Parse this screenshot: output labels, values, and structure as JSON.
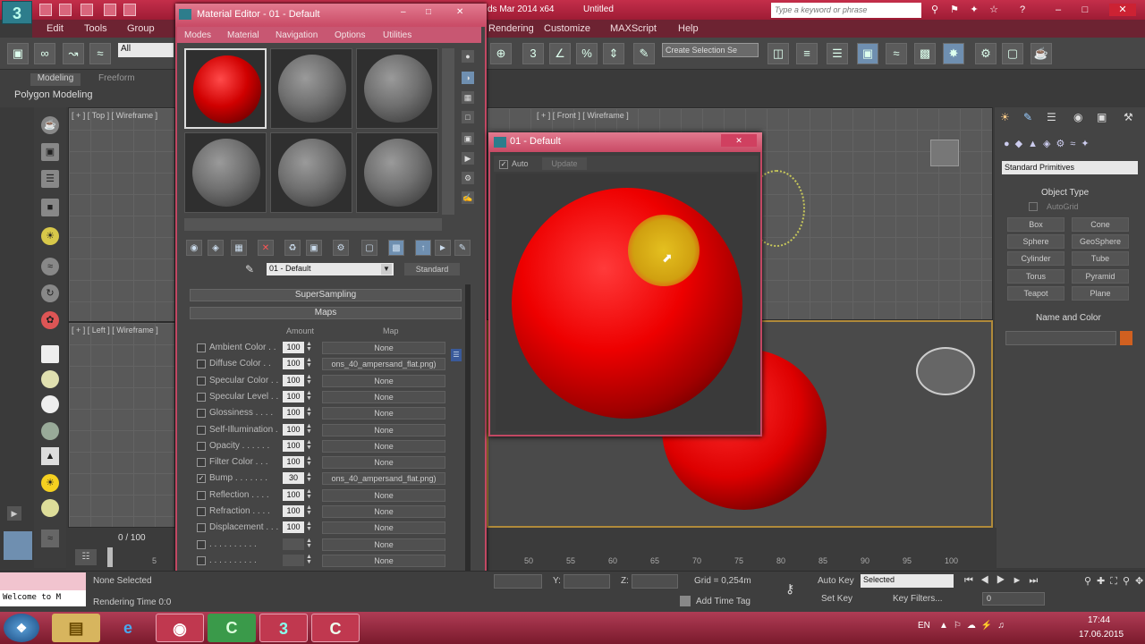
{
  "app": {
    "title_fragment": "ds Mar 2014 x64",
    "doc_title": "Untitled",
    "search_placeholder": "Type a keyword or phrase",
    "app_icon": "3ds-max-icon"
  },
  "menubar": [
    "Edit",
    "Tools",
    "Group",
    "Rendering",
    "Customize",
    "MAXScript",
    "Help"
  ],
  "toolbar": {
    "selection_filter": "All",
    "named_selection": "Create Selection Se"
  },
  "ribbon": {
    "tabs": [
      "Modeling",
      "Freeform"
    ],
    "sub": "Polygon Modeling"
  },
  "viewports": {
    "top": "[ + ] [ Top ] [ Wireframe ]",
    "front": "[ + ] [ Front ] [ Wireframe ]",
    "left": "[ + ] [ Left ] [ Wireframe ]"
  },
  "material_editor": {
    "title": "Material Editor - 01 - Default",
    "menus": [
      "Modes",
      "Material",
      "Navigation",
      "Options",
      "Utilities"
    ],
    "material_name": "01 - Default",
    "material_type": "Standard",
    "rollouts": {
      "supersampling": "SuperSampling",
      "maps": "Maps"
    },
    "maps_header": {
      "amount": "Amount",
      "map": "Map"
    },
    "maps": [
      {
        "label": "Ambient Color . .",
        "amount": "100",
        "map": "None",
        "checked": false
      },
      {
        "label": "Diffuse Color . .",
        "amount": "100",
        "map": "ons_40_ampersand_flat.png)",
        "checked": false
      },
      {
        "label": "Specular Color . .",
        "amount": "100",
        "map": "None",
        "checked": false
      },
      {
        "label": "Specular Level . .",
        "amount": "100",
        "map": "None",
        "checked": false
      },
      {
        "label": "Glossiness . . . .",
        "amount": "100",
        "map": "None",
        "checked": false
      },
      {
        "label": "Self-Illumination .",
        "amount": "100",
        "map": "None",
        "checked": false
      },
      {
        "label": "Opacity . . . . . .",
        "amount": "100",
        "map": "None",
        "checked": false
      },
      {
        "label": "Filter Color . . .",
        "amount": "100",
        "map": "None",
        "checked": false
      },
      {
        "label": "Bump . . . . . . .",
        "amount": "30",
        "map": "ons_40_ampersand_flat.png)",
        "checked": true
      },
      {
        "label": "Reflection . . . .",
        "amount": "100",
        "map": "None",
        "checked": false
      },
      {
        "label": "Refraction . . . .",
        "amount": "100",
        "map": "None",
        "checked": false
      },
      {
        "label": "Displacement . . .",
        "amount": "100",
        "map": "None",
        "checked": false
      },
      {
        "label": ". . . . . . . . . .",
        "amount": "",
        "map": "None",
        "checked": false
      },
      {
        "label": ". . . . . . . . . .",
        "amount": "",
        "map": "None",
        "checked": false
      },
      {
        "label": ". . . . . . . . . .",
        "amount": "",
        "map": "None",
        "checked": false
      }
    ]
  },
  "preview": {
    "title": "01 - Default",
    "auto_label": "Auto",
    "update_label": "Update"
  },
  "command_panel": {
    "dropdown": "Standard Primitives",
    "object_type_title": "Object Type",
    "autogrid": "AutoGrid",
    "buttons": [
      "Box",
      "Cone",
      "Sphere",
      "GeoSphere",
      "Cylinder",
      "Tube",
      "Torus",
      "Pyramid",
      "Teapot",
      "Plane"
    ],
    "name_color_title": "Name and Color"
  },
  "timeline": {
    "frame": "0 / 100",
    "ticks": [
      "50",
      "55",
      "60",
      "65",
      "70",
      "75",
      "80",
      "85",
      "90",
      "95",
      "100"
    ],
    "left_ticks": [
      "5"
    ]
  },
  "status": {
    "selection": "None Selected",
    "render_time": "Rendering Time  0:0",
    "welcome": "Welcome to M",
    "y_label": "Y:",
    "z_label": "Z:",
    "grid": "Grid = 0,254m",
    "add_time_tag": "Add Time Tag",
    "auto_key": "Auto Key",
    "set_key": "Set Key",
    "key_mode": "Selected",
    "key_filters": "Key Filters...",
    "frame_field": "0"
  },
  "taskbar": {
    "lang": "EN",
    "time": "17:44",
    "date": "17.06.2015",
    "apps": [
      "windows-start-icon",
      "explorer-icon",
      "ie-icon",
      "chrome-icon",
      "camtasia-icon",
      "3dsmax-icon",
      "camtasia-recorder-icon"
    ]
  },
  "colors": {
    "accent": "#c42e4a",
    "sphere_red": "#e00000",
    "highlight": "#e4c020"
  }
}
